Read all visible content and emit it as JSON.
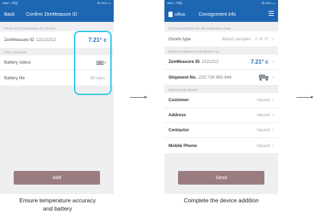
{
  "screen1": {
    "status": {
      "carrier": "●●●○○ 中国",
      "battery": "⁂ 82% ▭"
    },
    "nav": {
      "back": "Back",
      "title": "Confirm ZenMeasure ID"
    },
    "hint1": "Please check ZenMeasure ID, continue",
    "device_row": {
      "label": "ZenMeasure ID",
      "id": "12121212",
      "temperature": "7.21° c"
    },
    "hint2": "Other information",
    "battery_status_label": "Battery status",
    "battery_life": {
      "label": "Battery life",
      "value": "98 days"
    },
    "add_button": "Add"
  },
  "screen2": {
    "status": {
      "carrier": "●●●○○ 中国",
      "battery": "⁂ 82% ▭"
    },
    "nav": {
      "office": "office",
      "title": "Consignment info"
    },
    "hint1": "Choose goods type and safe temperature range",
    "goods": {
      "label": "Goods type",
      "value": "Blood samples",
      "range": "2~8 °C"
    },
    "hint2": "Binding ZenMeasure and Shipment No.",
    "device_row": {
      "label": "ZenMeasure ID",
      "id": "2121212",
      "temperature": "7.21° c"
    },
    "shipment": {
      "label": "Shipment No.",
      "value": "223 728 983 944"
    },
    "hint3": "Shipment info (Option)",
    "fields": [
      {
        "label": "Customer",
        "value": "Vacant"
      },
      {
        "label": "Address",
        "value": "Vacant"
      },
      {
        "label": "Contactor",
        "value": "Vacant"
      },
      {
        "label": "Mobile Phone",
        "value": "Vacant"
      }
    ],
    "send_button": "Send"
  },
  "captions": {
    "step1": "Ensure temperature accuracy and battery",
    "step2": "Complete  the device addition"
  },
  "colors": {
    "navbar": "#1d66b2",
    "highlight": "#2ec7e6",
    "button": "#9a7b80",
    "temperature": "#1d66b2"
  }
}
